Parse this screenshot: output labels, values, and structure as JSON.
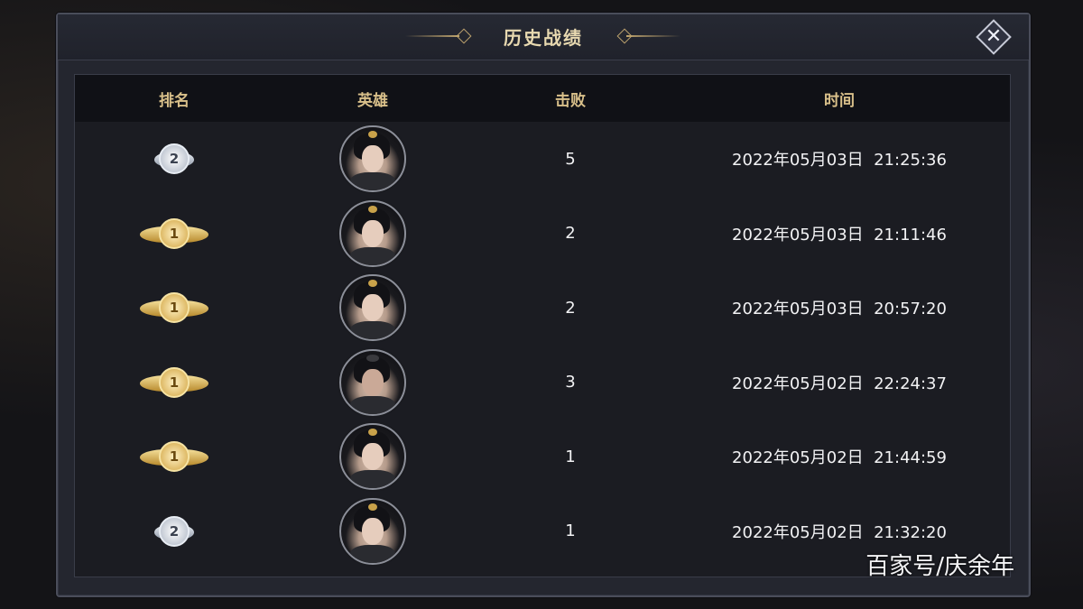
{
  "dialog": {
    "title": "历史战绩",
    "close_icon": "close-icon"
  },
  "table": {
    "headers": {
      "rank": "排名",
      "hero": "英雄",
      "kills": "击败",
      "time": "时间"
    },
    "rows": [
      {
        "rank": "2",
        "rank_tier": "silver",
        "hero_avatar": "female",
        "kills": "5",
        "time": "2022年05月03日  21:25:36"
      },
      {
        "rank": "1",
        "rank_tier": "gold",
        "hero_avatar": "female",
        "kills": "2",
        "time": "2022年05月03日  21:11:46"
      },
      {
        "rank": "1",
        "rank_tier": "gold",
        "hero_avatar": "female",
        "kills": "2",
        "time": "2022年05月03日  20:57:20"
      },
      {
        "rank": "1",
        "rank_tier": "gold",
        "hero_avatar": "male",
        "kills": "3",
        "time": "2022年05月02日  22:24:37"
      },
      {
        "rank": "1",
        "rank_tier": "gold",
        "hero_avatar": "female",
        "kills": "1",
        "time": "2022年05月02日  21:44:59"
      },
      {
        "rank": "2",
        "rank_tier": "silver",
        "hero_avatar": "female",
        "kills": "1",
        "time": "2022年05月02日  21:32:20"
      }
    ]
  },
  "watermark": "百家号/庆余年"
}
